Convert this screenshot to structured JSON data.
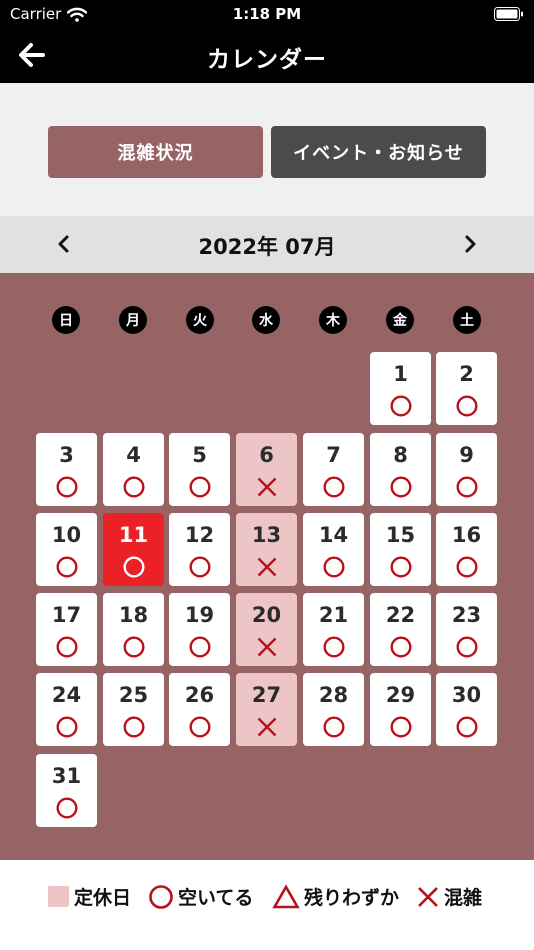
{
  "status_bar": {
    "carrier": "Carrier",
    "time": "1:18 PM"
  },
  "nav": {
    "title": "カレンダー"
  },
  "segments": {
    "crowd_label": "混雑状況",
    "event_label": "イベント・お知らせ"
  },
  "month": {
    "label": "2022年 07月"
  },
  "weekdays": [
    "日",
    "月",
    "火",
    "水",
    "木",
    "金",
    "土"
  ],
  "days": [
    {
      "day": "1",
      "status": "available",
      "closed": false,
      "today": false
    },
    {
      "day": "2",
      "status": "available",
      "closed": false,
      "today": false
    },
    {
      "day": "3",
      "status": "available",
      "closed": false,
      "today": false
    },
    {
      "day": "4",
      "status": "available",
      "closed": false,
      "today": false
    },
    {
      "day": "5",
      "status": "available",
      "closed": false,
      "today": false
    },
    {
      "day": "6",
      "status": "crowded",
      "closed": true,
      "today": false
    },
    {
      "day": "7",
      "status": "available",
      "closed": false,
      "today": false
    },
    {
      "day": "8",
      "status": "available",
      "closed": false,
      "today": false
    },
    {
      "day": "9",
      "status": "available",
      "closed": false,
      "today": false
    },
    {
      "day": "10",
      "status": "available",
      "closed": false,
      "today": false
    },
    {
      "day": "11",
      "status": "available",
      "closed": false,
      "today": true
    },
    {
      "day": "12",
      "status": "available",
      "closed": false,
      "today": false
    },
    {
      "day": "13",
      "status": "crowded",
      "closed": true,
      "today": false
    },
    {
      "day": "14",
      "status": "available",
      "closed": false,
      "today": false
    },
    {
      "day": "15",
      "status": "available",
      "closed": false,
      "today": false
    },
    {
      "day": "16",
      "status": "available",
      "closed": false,
      "today": false
    },
    {
      "day": "17",
      "status": "available",
      "closed": false,
      "today": false
    },
    {
      "day": "18",
      "status": "available",
      "closed": false,
      "today": false
    },
    {
      "day": "19",
      "status": "available",
      "closed": false,
      "today": false
    },
    {
      "day": "20",
      "status": "crowded",
      "closed": true,
      "today": false
    },
    {
      "day": "21",
      "status": "available",
      "closed": false,
      "today": false
    },
    {
      "day": "22",
      "status": "available",
      "closed": false,
      "today": false
    },
    {
      "day": "23",
      "status": "available",
      "closed": false,
      "today": false
    },
    {
      "day": "24",
      "status": "available",
      "closed": false,
      "today": false
    },
    {
      "day": "25",
      "status": "available",
      "closed": false,
      "today": false
    },
    {
      "day": "26",
      "status": "available",
      "closed": false,
      "today": false
    },
    {
      "day": "27",
      "status": "crowded",
      "closed": true,
      "today": false
    },
    {
      "day": "28",
      "status": "available",
      "closed": false,
      "today": false
    },
    {
      "day": "29",
      "status": "available",
      "closed": false,
      "today": false
    },
    {
      "day": "30",
      "status": "available",
      "closed": false,
      "today": false
    },
    {
      "day": "31",
      "status": "available",
      "closed": false,
      "today": false
    }
  ],
  "legend": {
    "closed": "定休日",
    "available": "空いてる",
    "few_left": "残りわずか",
    "crowded": "混雑"
  },
  "colors": {
    "accent": "#976465",
    "closed_bg": "#eec5c6",
    "today_bg": "#ea2126",
    "mark": "#b5121b",
    "event_button": "#4b4b4b"
  }
}
